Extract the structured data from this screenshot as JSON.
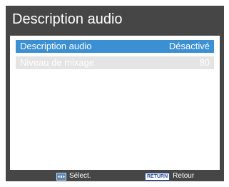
{
  "menu": {
    "title": "Description audio"
  },
  "items": [
    {
      "label": "Description audio",
      "value": "Désactivé",
      "state": "selected"
    },
    {
      "label": "Niveau de mixage",
      "value": "80",
      "state": "disabled"
    }
  ],
  "footer": {
    "select_icon": "dpad-icon",
    "select_label": "Sélect.",
    "return_badge": "RETURN",
    "return_label": "Retour"
  },
  "colors": {
    "menu_background": "#464646",
    "selected_row": "#3b8fd3",
    "disabled_row": "#e4e4e4"
  }
}
